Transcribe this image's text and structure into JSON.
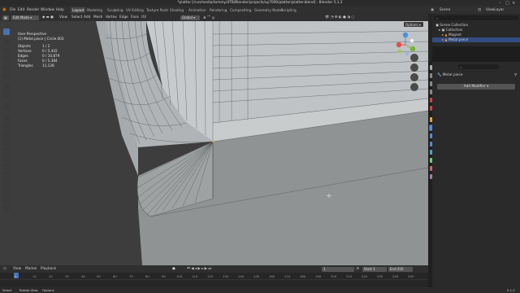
{
  "window": {
    "title": "*platter [/run/media/tommy/4TB/Blender/projects/xp7000/platter/platter.blend] - Blender 5.1.2"
  },
  "menu": [
    "File",
    "Edit",
    "Render",
    "Window",
    "Help"
  ],
  "workspaces": [
    "Layout",
    "Modeling",
    "Sculpting",
    "UV Editing",
    "Texture Paint",
    "Shading",
    "Animation",
    "Rendering",
    "Compositing",
    "Geometry Nodes",
    "Scripting"
  ],
  "scene": {
    "label": "Scene",
    "view_layer": "ViewLayer"
  },
  "viewport_header": {
    "mode": "Edit Mode",
    "menus": [
      "View",
      "Select",
      "Add",
      "Mesh",
      "Vertex",
      "Edge",
      "Face",
      "UV"
    ],
    "orientation": "Global",
    "options": "Options"
  },
  "overlay": {
    "view": "User Perspective",
    "object": "(1) Metal piece | Circle.003",
    "stats": [
      {
        "label": "Objects",
        "value": "1 / 2"
      },
      {
        "label": "Vertices",
        "value": "0 / 5,442"
      },
      {
        "label": "Edges",
        "value": "0 / 10,879"
      },
      {
        "label": "Faces",
        "value": "0 / 5,384"
      },
      {
        "label": "Triangles",
        "value": "11,128"
      }
    ]
  },
  "gizmo": {
    "x": "X",
    "y": "Y",
    "z": "Z"
  },
  "timeline": {
    "menus": [
      "View",
      "Marker",
      "Playback"
    ],
    "current_frame": "1",
    "start_label": "Start",
    "start": "1",
    "end_label": "End",
    "end": "250",
    "ticks": [
      "1",
      "10",
      "20",
      "30",
      "40",
      "50",
      "60",
      "70",
      "80",
      "90",
      "100",
      "110",
      "120",
      "130",
      "140",
      "150",
      "160",
      "170",
      "180",
      "190",
      "200",
      "210",
      "220",
      "230",
      "240",
      "250"
    ]
  },
  "status": {
    "left": [
      "Select",
      "Rotate View",
      "Options"
    ],
    "right": "5.1.2"
  },
  "outliner": {
    "search_placeholder": "",
    "items": [
      {
        "label": "Scene Collection",
        "indent": 0
      },
      {
        "label": "Collection",
        "indent": 1
      },
      {
        "label": "Magnet",
        "indent": 2
      },
      {
        "label": "Metal piece",
        "indent": 2
      }
    ]
  },
  "properties": {
    "object_name": "Metal piece",
    "add_modifier": "Add Modifier"
  },
  "colors": {
    "accent": "#4772b3",
    "selection": "#334d80",
    "x_axis": "#e24d4d",
    "y_axis": "#74b234",
    "z_axis": "#4a90e2"
  }
}
